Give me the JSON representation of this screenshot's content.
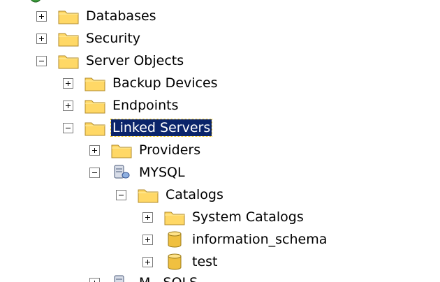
{
  "tree": {
    "nodes": [
      {
        "label": "Databases",
        "icon": "folder-icon",
        "expander": "plus"
      },
      {
        "label": "Security",
        "icon": "folder-icon",
        "expander": "plus"
      },
      {
        "label": "Server Objects",
        "icon": "folder-icon",
        "expander": "minus"
      },
      {
        "label": "Backup Devices",
        "icon": "folder-icon",
        "expander": "plus"
      },
      {
        "label": "Endpoints",
        "icon": "folder-icon",
        "expander": "plus"
      },
      {
        "label": "Linked Servers",
        "icon": "folder-icon",
        "expander": "minus",
        "selected": true
      },
      {
        "label": "Providers",
        "icon": "folder-icon",
        "expander": "plus"
      },
      {
        "label": "MYSQL",
        "icon": "linked-server-icon",
        "expander": "minus"
      },
      {
        "label": "Catalogs",
        "icon": "folder-icon",
        "expander": "minus"
      },
      {
        "label": "System Catalogs",
        "icon": "folder-icon",
        "expander": "plus"
      },
      {
        "label": "information_schema",
        "icon": "database-icon",
        "expander": "plus"
      },
      {
        "label": "test",
        "icon": "database-icon",
        "expander": "plus"
      },
      {
        "label": "M...SQLS...",
        "icon": "linked-server-icon",
        "expander": "plus"
      }
    ]
  },
  "colors": {
    "selection_background": "#0a246a",
    "selection_text": "#ffffff",
    "folder_fill": "#ffd866",
    "folder_stroke": "#b08a2a",
    "database_fill": "#f0c040"
  }
}
